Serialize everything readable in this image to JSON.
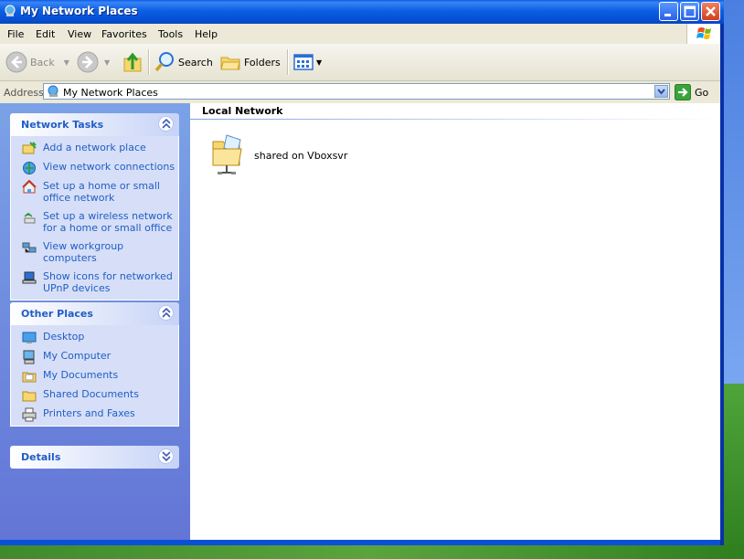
{
  "window": {
    "title": "My Network Places"
  },
  "menu": [
    "File",
    "Edit",
    "View",
    "Favorites",
    "Tools",
    "Help"
  ],
  "toolbar": {
    "back_label": "Back",
    "search_label": "Search",
    "folders_label": "Folders"
  },
  "address": {
    "label": "Address",
    "value": "My Network Places",
    "go_label": "Go"
  },
  "network_tasks": {
    "title": "Network Tasks",
    "items": [
      {
        "label": "Add a network place",
        "icon": "add-network-place-icon"
      },
      {
        "label": "View network connections",
        "icon": "network-connections-icon"
      },
      {
        "label": "Set up a home or small office network",
        "icon": "home-network-icon"
      },
      {
        "label": "Set up a wireless network for a home or small office",
        "icon": "wireless-network-icon"
      },
      {
        "label": "View workgroup computers",
        "icon": "workgroup-icon"
      },
      {
        "label": "Show icons for networked UPnP devices",
        "icon": "upnp-icon"
      }
    ]
  },
  "other_places": {
    "title": "Other Places",
    "items": [
      {
        "label": "Desktop",
        "icon": "desktop-icon"
      },
      {
        "label": "My Computer",
        "icon": "my-computer-icon"
      },
      {
        "label": "My Documents",
        "icon": "my-documents-icon"
      },
      {
        "label": "Shared Documents",
        "icon": "shared-documents-icon"
      },
      {
        "label": "Printers and Faxes",
        "icon": "printer-icon"
      }
    ]
  },
  "details": {
    "title": "Details"
  },
  "content": {
    "group": "Local Network",
    "items": [
      {
        "label": "shared on Vboxsvr",
        "icon": "network-share-folder-icon"
      }
    ]
  },
  "colors": {
    "titlebar": "#0a5ce6",
    "link": "#215dc6",
    "taskpane": "#7ba2e7"
  }
}
